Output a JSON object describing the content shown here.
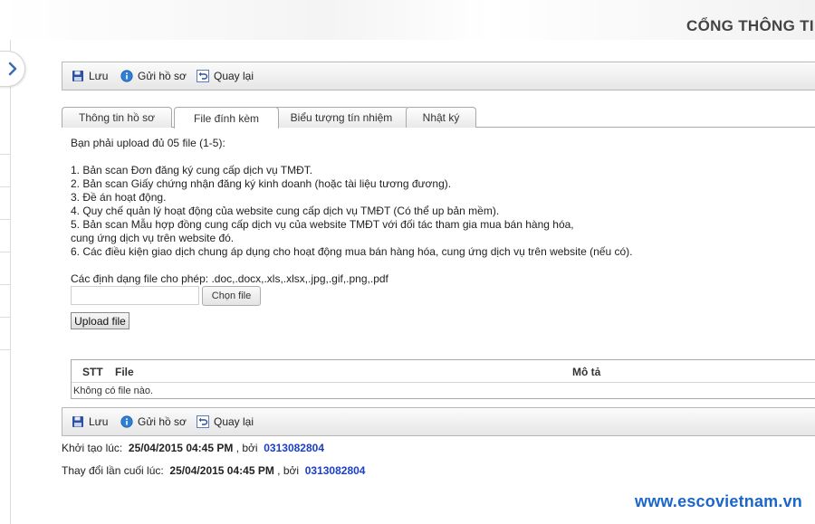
{
  "header": {
    "portal_title": "CỔNG THÔNG TIN"
  },
  "toolbar": {
    "save": "Lưu",
    "submit": "Gửi hồ sơ",
    "back": "Quay lại"
  },
  "tabs": [
    {
      "label": "Thông tin hồ sơ",
      "active": false
    },
    {
      "label": "File đính kèm",
      "active": true
    },
    {
      "label": "Biểu tượng tín nhiệm",
      "active": false
    },
    {
      "label": "Nhật ký",
      "active": false
    }
  ],
  "content": {
    "intro": "Bạn phải upload đủ 05 file (1-5):",
    "requirements": [
      "1. Bản scan Đơn đăng ký cung cấp dịch vụ TMĐT.",
      "2. Bản scan Giấy chứng nhận đăng ký kinh doanh (hoặc tài liệu tương đương).",
      "3. Đề án hoạt động.",
      "4. Quy chế quản lý hoạt động của website cung cấp dịch vụ TMĐT (Có thể up bản mềm).",
      "5. Bản scan Mẫu hợp đồng cung cấp dịch vụ của website TMĐT với đối tác tham gia mua bán hàng hóa,",
      "cung ứng dịch vụ trên website đó.",
      "6. Các điều kiện giao dịch chung áp dụng cho hoạt động mua bán hàng hóa, cung ứng dịch vụ trên website (nếu có)."
    ],
    "formats_label": "Các định dạng file cho phép: .doc,.docx,.xls,.xlsx,.jpg,.gif,.png,.pdf",
    "choose_file": "Chọn file",
    "upload_button": "Upload file"
  },
  "file_table": {
    "columns": [
      "STT",
      "File",
      "Mô tả"
    ],
    "empty_text": "Không có file nào."
  },
  "meta": {
    "created_label": "Khởi tạo lúc:",
    "created_time": "25/04/2015 04:45 PM",
    "by": ", bởi",
    "created_by": "0313082804",
    "modified_label": "Thay đổi lần cuối lúc:",
    "modified_time": "25/04/2015 04:45 PM",
    "modified_by": "0313082804"
  },
  "watermark": "www.escovietnam.vn",
  "colors": {
    "link": "#1a3fc6",
    "watermark": "#1b66c9",
    "save_icon": "#2f4f9f",
    "info_icon": "#2e7fd6"
  },
  "icons": {
    "save": "floppy-disk-icon",
    "submit": "info-circle-icon",
    "back": "undo-arrow-icon",
    "toggle": "chevron-right-icon"
  }
}
